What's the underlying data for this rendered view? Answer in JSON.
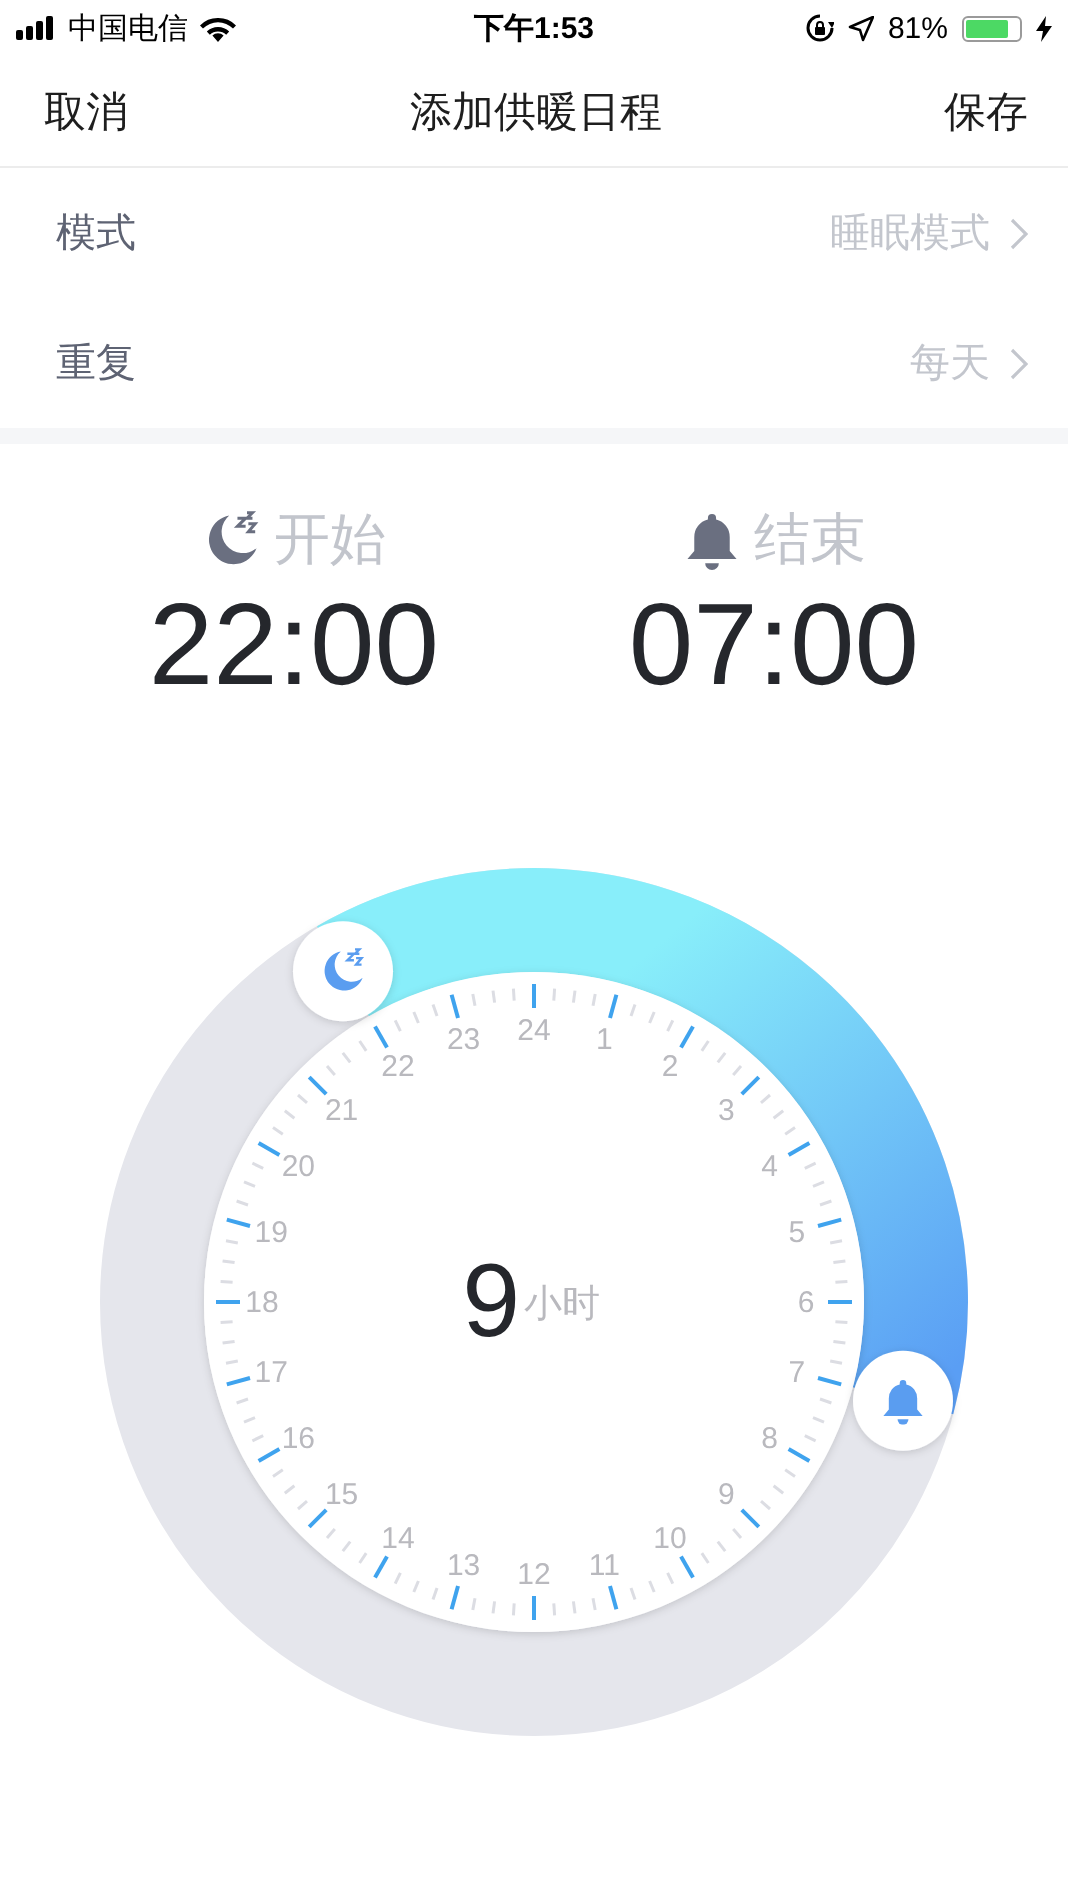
{
  "status_bar": {
    "carrier": "中国电信",
    "time": "下午1:53",
    "battery_text": "81%",
    "battery": {
      "level": 0.81
    },
    "charging": true
  },
  "nav": {
    "cancel": "取消",
    "title": "添加供暖日程",
    "save": "保存"
  },
  "settings": [
    {
      "label": "模式",
      "value": "睡眠模式"
    },
    {
      "label": "重复",
      "value": "每天"
    }
  ],
  "schedule": {
    "start": {
      "label": "开始",
      "time": "22:00"
    },
    "end": {
      "label": "结束",
      "time": "07:00"
    }
  },
  "dial": {
    "duration": "9",
    "unit": "小时",
    "numbers": [
      "24",
      "23",
      "1",
      "22",
      "2",
      "21",
      "3",
      "20",
      "4",
      "19",
      "5",
      "18",
      "6",
      "17",
      "7",
      "16",
      "8",
      "15",
      "9",
      "14",
      "10",
      "13",
      "11",
      "12"
    ]
  }
}
